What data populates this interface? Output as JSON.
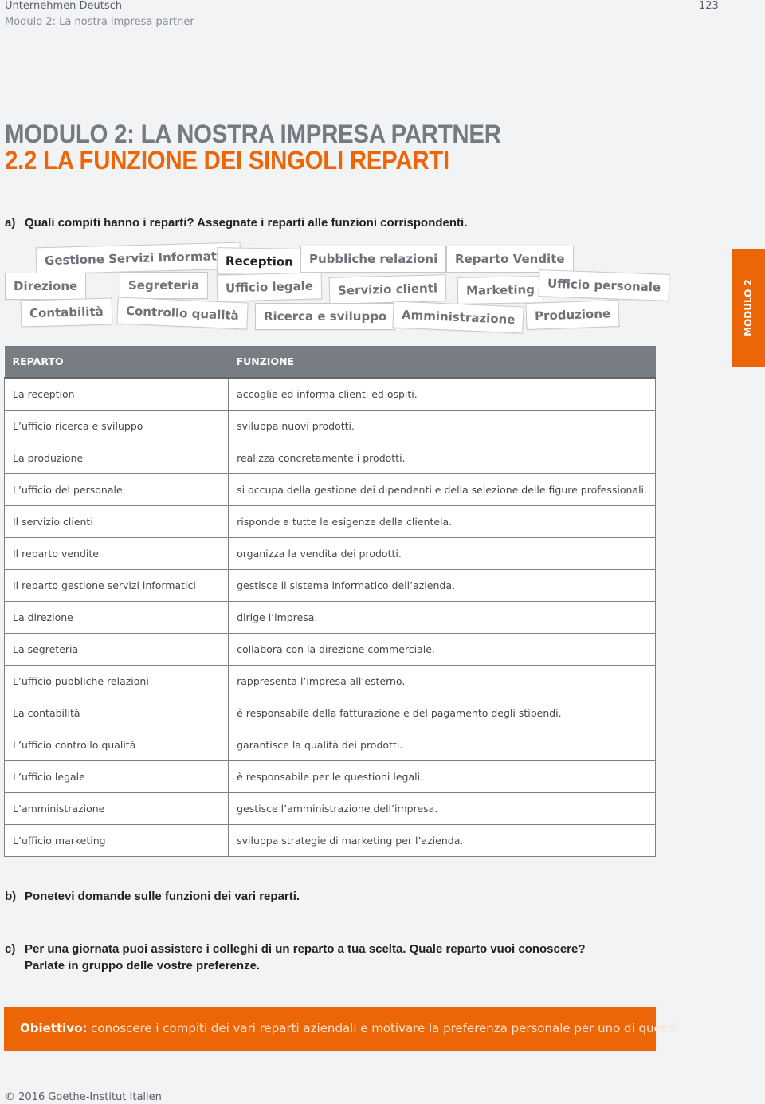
{
  "header": {
    "book_title": "Unternehmen Deutsch",
    "module_subtitle": "Modulo 2: La nostra impresa partner",
    "page_number": "123"
  },
  "titles": {
    "module_title": "MODULO 2: LA NOSTRA IMPRESA PARTNER",
    "section_title": "2.2 LA FUNZIONE DEI SINGOLI REPARTI"
  },
  "side_tab": {
    "label": "MODULO 2"
  },
  "task_a": {
    "letter": "a)",
    "text": "Quali compiti hanno i reparti? Assegnate i reparti alle funzioni corrispondenti."
  },
  "word_tags": [
    "Gestione Servizi Informatici",
    "Reception",
    "Pubbliche relazioni",
    "Reparto Vendite",
    "Direzione",
    "Segreteria",
    "Ufficio legale",
    "Servizio clienti",
    "Marketing",
    "Ufficio personale",
    "Contabilità",
    "Controllo qualità",
    "Ricerca e sviluppo",
    "Amministrazione",
    "Produzione"
  ],
  "table": {
    "headers": [
      "REPARTO",
      "FUNZIONE"
    ],
    "rows": [
      [
        "La reception",
        "accoglie ed informa clienti ed ospiti."
      ],
      [
        "L’ufficio ricerca e sviluppo",
        "sviluppa nuovi prodotti."
      ],
      [
        "La produzione",
        "realizza concretamente i prodotti."
      ],
      [
        "L’ufficio del personale",
        "si occupa della gestione dei dipendenti e della selezione delle figure professionali."
      ],
      [
        "Il servizio clienti",
        "risponde a tutte le esigenze della clientela."
      ],
      [
        "Il reparto vendite",
        "organizza la vendita dei prodotti."
      ],
      [
        "Il reparto gestione servizi informatici",
        "gestisce il sistema informatico dell’azienda."
      ],
      [
        "La direzione",
        "dirige l’impresa."
      ],
      [
        "La segreteria",
        "collabora con la direzione commerciale."
      ],
      [
        "L’ufficio pubbliche relazioni",
        "rappresenta l’impresa all’esterno."
      ],
      [
        "La contabilità",
        "è responsabile della fatturazione e del pagamento degli stipendi."
      ],
      [
        "L’ufficio controllo qualità",
        "garantisce la qualità dei prodotti."
      ],
      [
        "L’ufficio legale",
        "è responsabile per le questioni legali."
      ],
      [
        "L’amministrazione",
        "gestisce l’amministrazione dell’impresa."
      ],
      [
        "L’ufficio marketing",
        "sviluppa strategie di marketing per l’azienda."
      ]
    ]
  },
  "task_b": {
    "letter": "b)",
    "text": "Ponetevi domande sulle funzioni dei vari reparti."
  },
  "task_c": {
    "letter": "c)",
    "line1": "Per una giornata puoi assistere i colleghi di un reparto a tua scelta. Quale reparto vuoi conoscere?",
    "line2": "Parlate in gruppo delle vostre preferenze."
  },
  "goal": {
    "label": "Obiettivo:",
    "text": " conoscere i compiti dei vari reparti aziendali e motivare la preferenza personale per uno di questi."
  },
  "footer": {
    "copyright": "© 2016 Goethe-Institut Italien"
  },
  "colors": {
    "accent_orange": "#ec6608",
    "header_gray": "#777d83",
    "title_gray": "#747a80"
  }
}
